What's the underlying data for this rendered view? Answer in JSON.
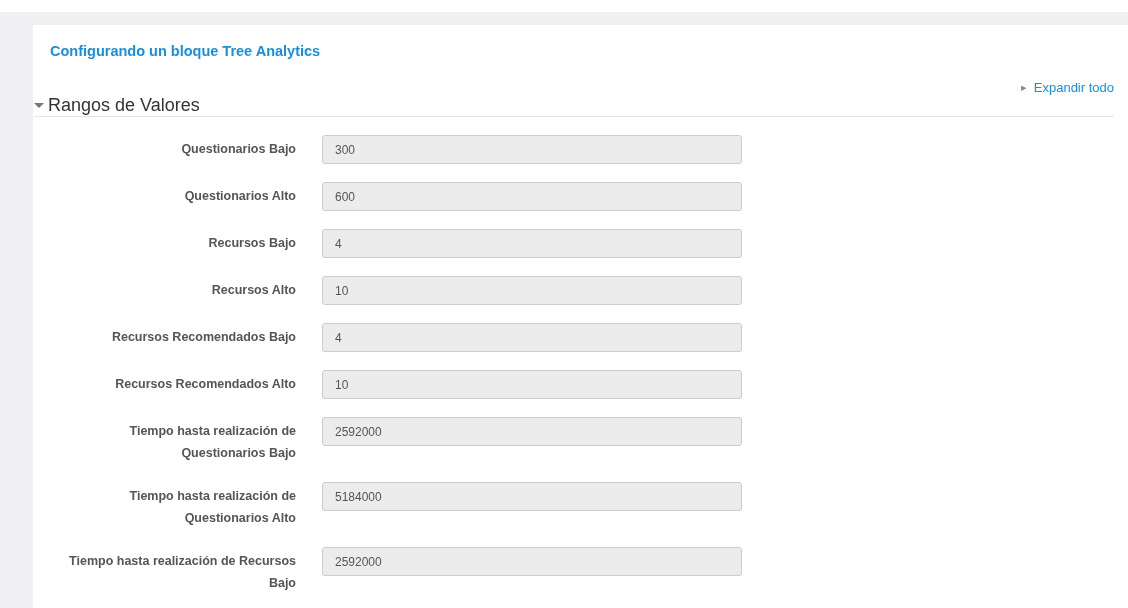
{
  "page_title": "Configurando un bloque Tree Analytics",
  "expand_all": {
    "label": "Expandir todo",
    "icon": "▸"
  },
  "section": {
    "title": "Rangos de Valores",
    "expanded": true,
    "fields": [
      {
        "label": "Questionarios Bajo",
        "value": "300"
      },
      {
        "label": "Questionarios Alto",
        "value": "600"
      },
      {
        "label": "Recursos Bajo",
        "value": "4"
      },
      {
        "label": "Recursos Alto",
        "value": "10"
      },
      {
        "label": "Recursos Recomendados Bajo",
        "value": "4"
      },
      {
        "label": "Recursos Recomendados Alto",
        "value": "10"
      },
      {
        "label": "Tiempo hasta realización de Questionarios Bajo",
        "value": "2592000"
      },
      {
        "label": "Tiempo hasta realización de Questionarios Alto",
        "value": "5184000"
      },
      {
        "label": "Tiempo hasta realización de Recursos Bajo",
        "value": "2592000"
      }
    ]
  }
}
